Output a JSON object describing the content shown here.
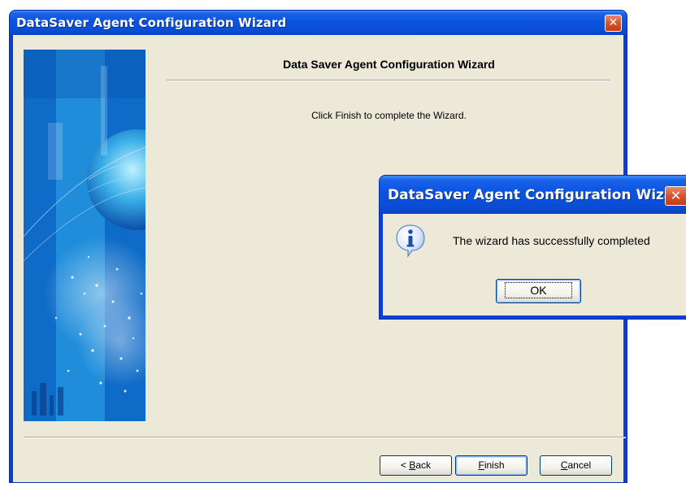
{
  "wizard": {
    "window_title": "DataSaver Agent Configuration Wizard",
    "close_glyph": "✕",
    "heading": "Data Saver Agent Configuration Wizard",
    "message": "Click Finish to complete the Wizard.",
    "buttons": {
      "back": {
        "pre": "< ",
        "key": "B",
        "post": "ack"
      },
      "finish": {
        "pre": "",
        "key": "F",
        "post": "inish"
      },
      "cancel": {
        "pre": "",
        "key": "C",
        "post": "ancel"
      }
    }
  },
  "dialog": {
    "title": "DataSaver Agent Configuration Wizard",
    "close_glyph": "✕",
    "icon": "info-icon",
    "text": "The wizard has successfully completed",
    "ok_label": "OK"
  },
  "colors": {
    "title_bar": "#0a4ed6",
    "client_bg": "#ece9d8",
    "close_button": "#d8532f"
  }
}
